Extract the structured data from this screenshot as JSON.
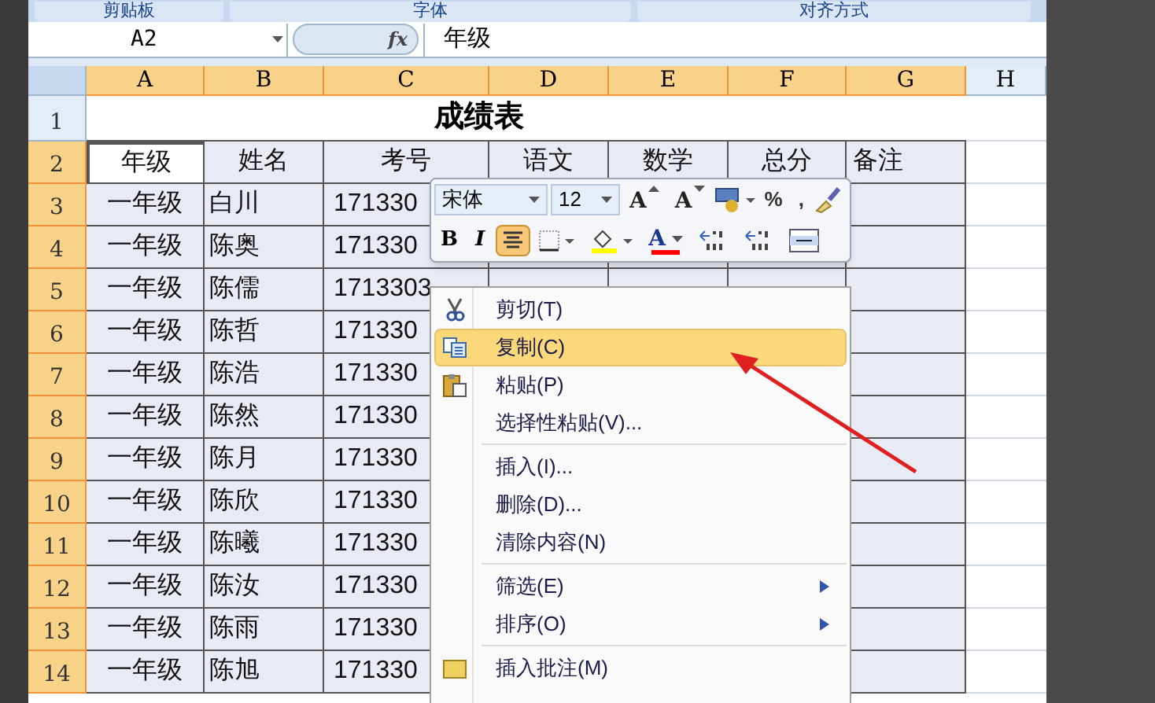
{
  "ribbon_groups": [
    "剪贴板",
    "字体",
    "对齐方式"
  ],
  "formula_bar": {
    "name_box": "A2",
    "fx": "fx",
    "value": "年级"
  },
  "columns": [
    {
      "label": "A",
      "selected": true
    },
    {
      "label": "B",
      "selected": true
    },
    {
      "label": "C",
      "selected": true
    },
    {
      "label": "D",
      "selected": true
    },
    {
      "label": "E",
      "selected": true
    },
    {
      "label": "F",
      "selected": true
    },
    {
      "label": "G",
      "selected": true
    },
    {
      "label": "H",
      "selected": false
    }
  ],
  "title": "成绩表",
  "headers": [
    "年级",
    "姓名",
    "考号",
    "语文",
    "数学",
    "总分",
    "备注"
  ],
  "rows": [
    {
      "num": "3",
      "grade": "一年级",
      "name": "白川",
      "id": "171330"
    },
    {
      "num": "4",
      "grade": "一年级",
      "name": "陈奥",
      "id": "171330"
    },
    {
      "num": "5",
      "grade": "一年级",
      "name": "陈儒",
      "id": "1713303"
    },
    {
      "num": "6",
      "grade": "一年级",
      "name": "陈哲",
      "id": "171330"
    },
    {
      "num": "7",
      "grade": "一年级",
      "name": "陈浩",
      "id": "171330"
    },
    {
      "num": "8",
      "grade": "一年级",
      "name": "陈然",
      "id": "171330"
    },
    {
      "num": "9",
      "grade": "一年级",
      "name": "陈月",
      "id": "171330"
    },
    {
      "num": "10",
      "grade": "一年级",
      "name": "陈欣",
      "id": "171330"
    },
    {
      "num": "11",
      "grade": "一年级",
      "name": "陈曦",
      "id": "171330"
    },
    {
      "num": "12",
      "grade": "一年级",
      "name": "陈汝",
      "id": "171330"
    },
    {
      "num": "13",
      "grade": "一年级",
      "name": "陈雨",
      "id": "171330"
    },
    {
      "num": "14",
      "grade": "一年级",
      "name": "陈旭",
      "id": "171330"
    }
  ],
  "row_headers": [
    {
      "label": "1",
      "selected": false
    },
    {
      "label": "2",
      "selected": true
    }
  ],
  "mini_toolbar": {
    "font": "宋体",
    "size": "12",
    "top": [
      {
        "kind": "grow",
        "label": "A"
      },
      {
        "kind": "shrink",
        "label": "A"
      },
      {
        "kind": "accounting"
      },
      {
        "kind": "text",
        "label": "%"
      },
      {
        "kind": "text",
        "label": ","
      },
      {
        "kind": "painter"
      }
    ],
    "bottom": [
      {
        "kind": "bold",
        "label": "B",
        "selected": false
      },
      {
        "kind": "italic",
        "label": "I",
        "selected": false
      },
      {
        "kind": "align",
        "selected": true
      },
      {
        "kind": "borders",
        "selected": false
      },
      {
        "kind": "fill",
        "selected": false
      },
      {
        "kind": "fontcolor",
        "label": "A",
        "selected": false
      },
      {
        "kind": "incdec",
        "selected": false
      },
      {
        "kind": "decdec",
        "selected": false
      },
      {
        "kind": "merge",
        "selected": false
      }
    ]
  },
  "context_menu": [
    {
      "kind": "cut",
      "label": "剪切(T)",
      "selected": false,
      "submenu": false
    },
    {
      "kind": "copy",
      "label": "复制(C)",
      "selected": true,
      "submenu": false
    },
    {
      "kind": "paste",
      "label": "粘贴(P)",
      "selected": false,
      "submenu": false
    },
    {
      "kind": "plain",
      "label": "选择性粘贴(V)...",
      "selected": false,
      "submenu": false
    },
    {
      "kind": "separator"
    },
    {
      "kind": "plain",
      "label": "插入(I)...",
      "selected": false,
      "submenu": false
    },
    {
      "kind": "plain",
      "label": "删除(D)...",
      "selected": false,
      "submenu": false
    },
    {
      "kind": "plain",
      "label": "清除内容(N)",
      "selected": false,
      "submenu": false
    },
    {
      "kind": "separator"
    },
    {
      "kind": "plain",
      "label": "筛选(E)",
      "selected": false,
      "submenu": true
    },
    {
      "kind": "plain",
      "label": "排序(O)",
      "selected": false,
      "submenu": true
    },
    {
      "kind": "separator"
    },
    {
      "kind": "comment",
      "label": "插入批注(M)",
      "selected": false,
      "submenu": false
    }
  ]
}
